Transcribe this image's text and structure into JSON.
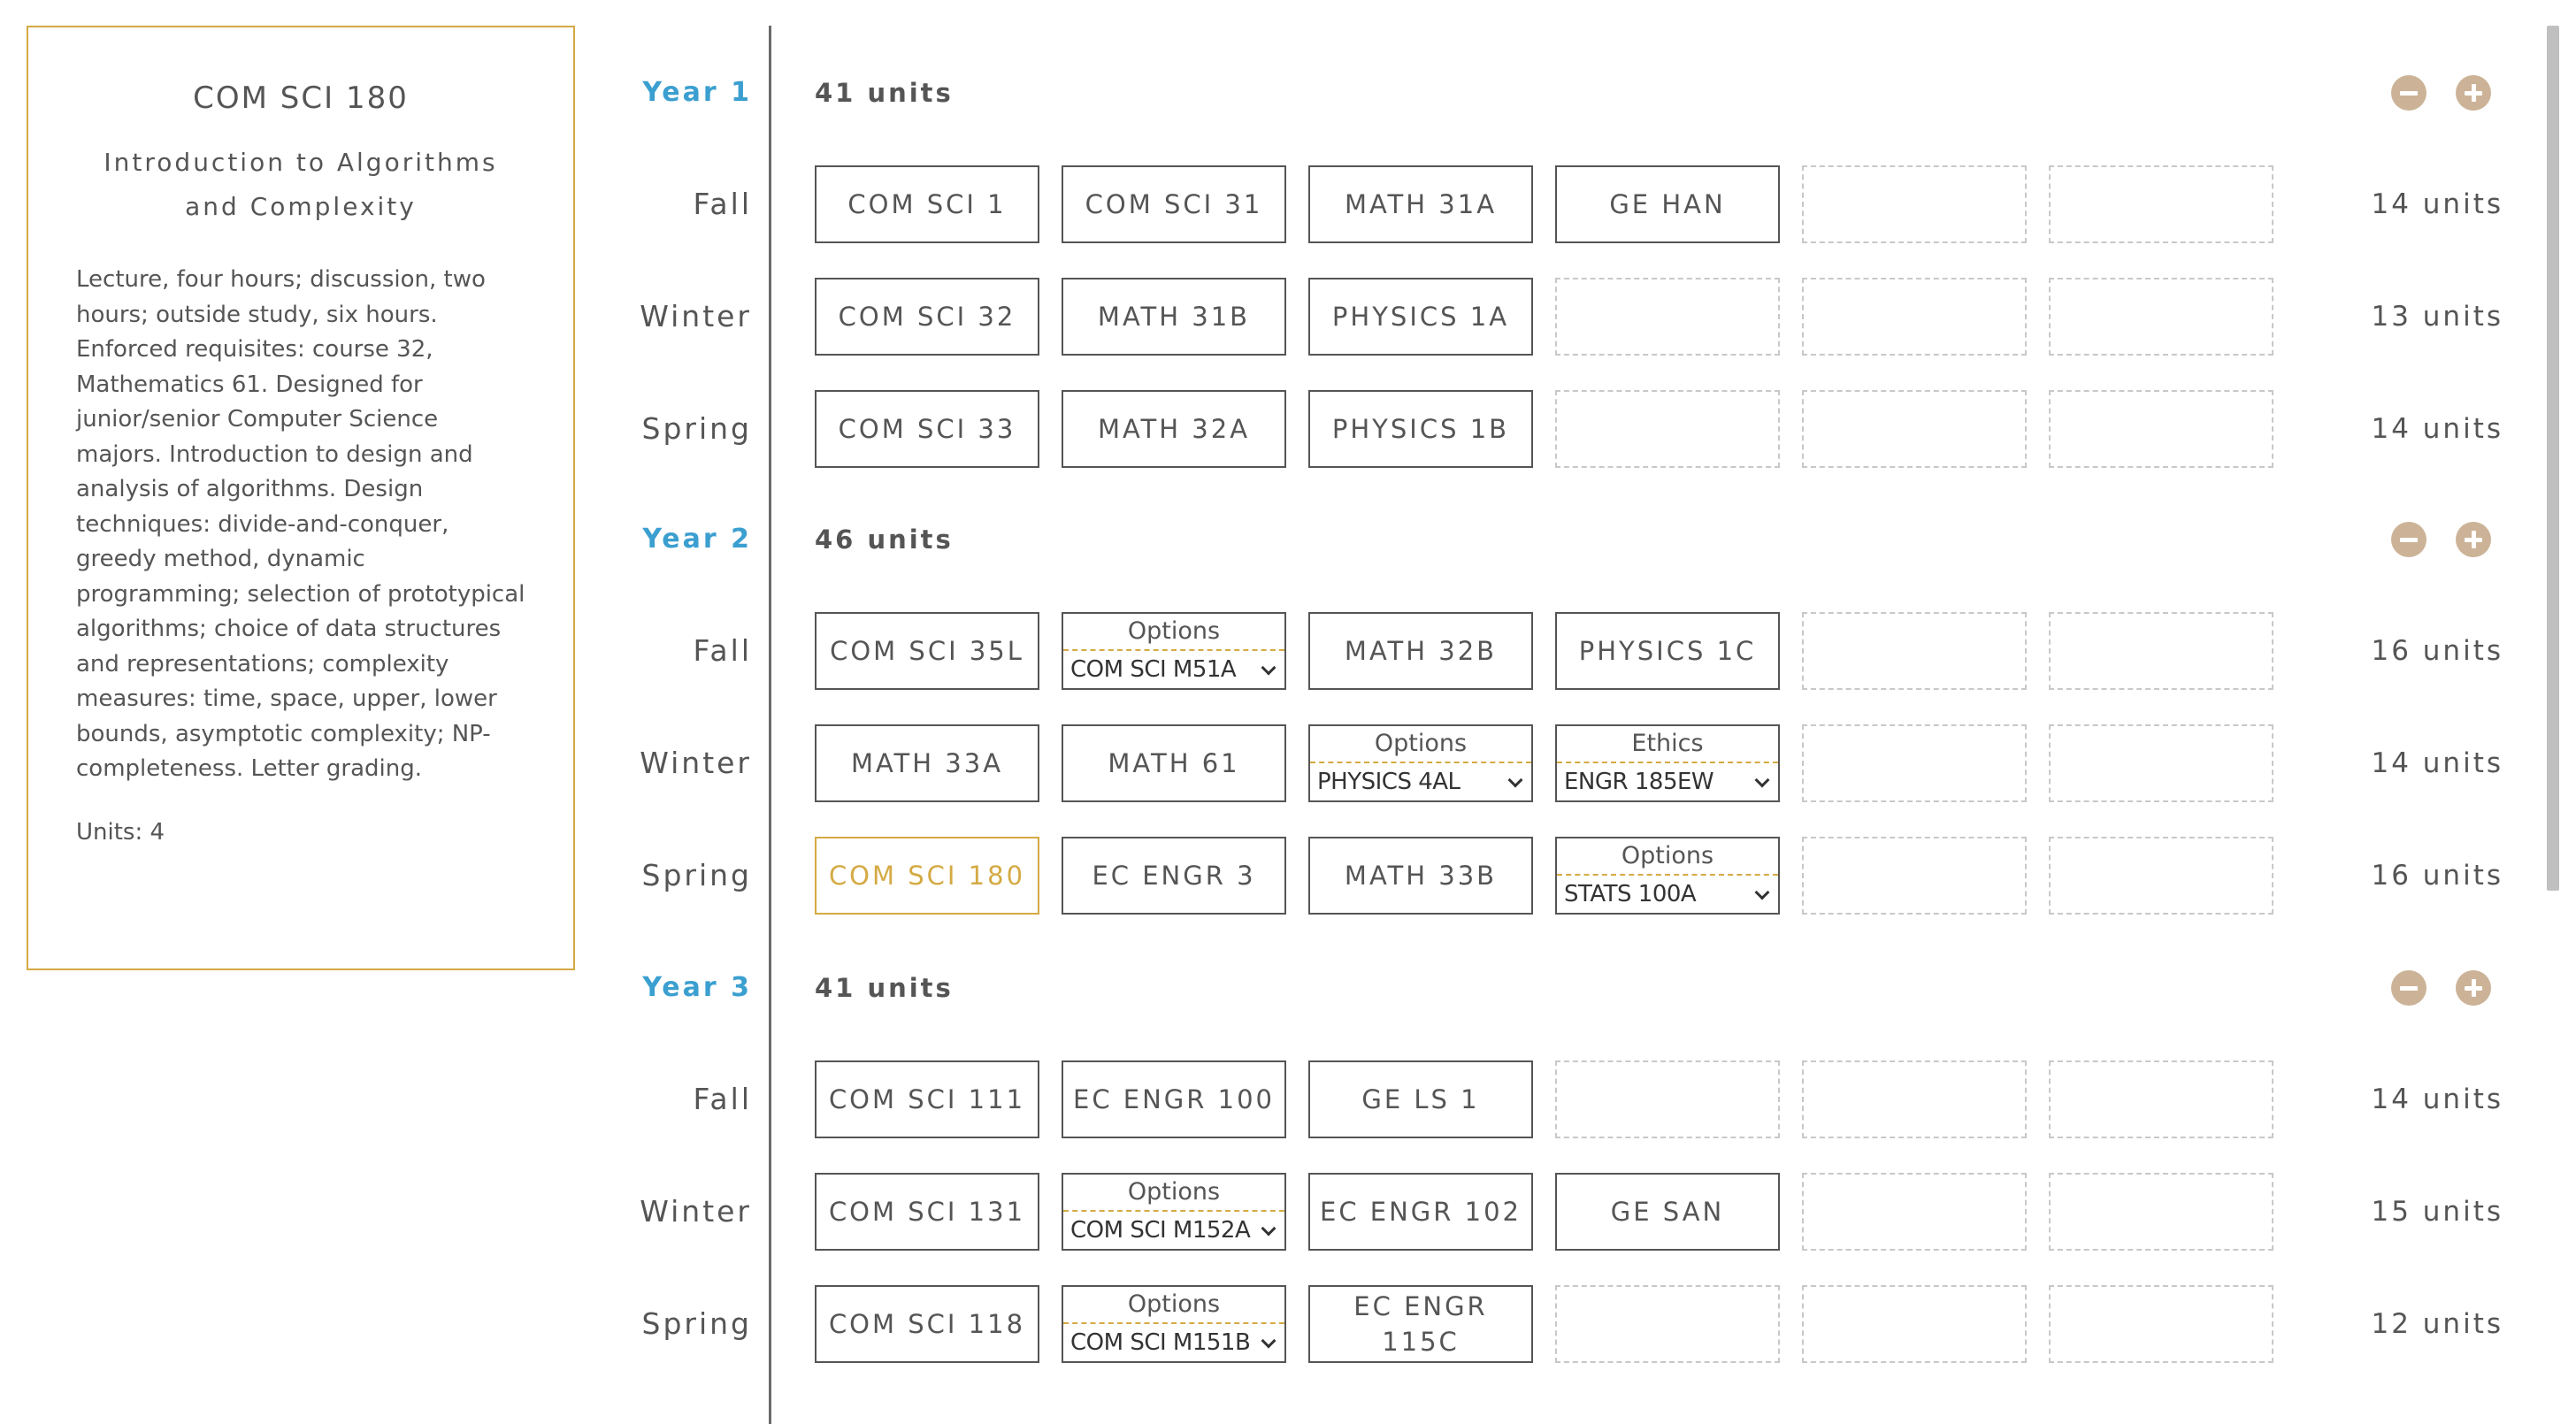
{
  "detail": {
    "code": "COM SCI 180",
    "title": "Introduction to Algorithms and Complexity",
    "description": "Lecture, four hours; discussion, two hours; outside study, six hours. Enforced requisites: course 32, Mathematics 61. Designed for junior/senior Computer Science majors. Introduction to design and analysis of algorithms. Design techniques: divide-and-conquer, greedy method, dynamic programming; selection of prototypical algorithms; choice of data structures and representations; complexity measures: time, space, upper, lower bounds, asymptotic complexity; NP-completeness. Letter grading.",
    "units": "Units: 4"
  },
  "colors": {
    "accent_gold": "#d4aa43",
    "year_blue": "#3b9fd0",
    "control_tan": "#ccb397"
  },
  "icons": {
    "remove_year": "minus-circle-icon",
    "add_year": "plus-circle-icon",
    "dropdown": "chevron-down-icon"
  },
  "years": [
    {
      "label": "Year 1",
      "units": "41 units",
      "terms": [
        {
          "label": "Fall",
          "units": "14 units",
          "slots": [
            {
              "type": "course",
              "text": "COM SCI 1"
            },
            {
              "type": "course",
              "text": "COM SCI 31"
            },
            {
              "type": "course",
              "text": "MATH 31A"
            },
            {
              "type": "course",
              "text": "GE HAN"
            },
            {
              "type": "empty"
            },
            {
              "type": "empty"
            }
          ]
        },
        {
          "label": "Winter",
          "units": "13 units",
          "slots": [
            {
              "type": "course",
              "text": "COM SCI 32"
            },
            {
              "type": "course",
              "text": "MATH 31B"
            },
            {
              "type": "course",
              "text": "PHYSICS 1A"
            },
            {
              "type": "empty"
            },
            {
              "type": "empty"
            },
            {
              "type": "empty"
            }
          ]
        },
        {
          "label": "Spring",
          "units": "14 units",
          "slots": [
            {
              "type": "course",
              "text": "COM SCI 33"
            },
            {
              "type": "course",
              "text": "MATH 32A"
            },
            {
              "type": "course",
              "text": "PHYSICS 1B"
            },
            {
              "type": "empty"
            },
            {
              "type": "empty"
            },
            {
              "type": "empty"
            }
          ]
        }
      ]
    },
    {
      "label": "Year 2",
      "units": "46 units",
      "terms": [
        {
          "label": "Fall",
          "units": "16 units",
          "slots": [
            {
              "type": "course",
              "text": "COM SCI 35L"
            },
            {
              "type": "option",
              "label": "Options",
              "value": "COM SCI M51A"
            },
            {
              "type": "course",
              "text": "MATH 32B"
            },
            {
              "type": "course",
              "text": "PHYSICS 1C"
            },
            {
              "type": "empty"
            },
            {
              "type": "empty"
            }
          ]
        },
        {
          "label": "Winter",
          "units": "14 units",
          "slots": [
            {
              "type": "course",
              "text": "MATH 33A"
            },
            {
              "type": "course",
              "text": "MATH 61"
            },
            {
              "type": "option",
              "label": "Options",
              "value": "PHYSICS 4AL"
            },
            {
              "type": "option",
              "label": "Ethics",
              "value": "ENGR 185EW"
            },
            {
              "type": "empty"
            },
            {
              "type": "empty"
            }
          ]
        },
        {
          "label": "Spring",
          "units": "16 units",
          "slots": [
            {
              "type": "course",
              "text": "COM SCI 180",
              "selected": true
            },
            {
              "type": "course",
              "text": "EC ENGR 3"
            },
            {
              "type": "course",
              "text": "MATH 33B"
            },
            {
              "type": "option",
              "label": "Options",
              "value": "STATS 100A"
            },
            {
              "type": "empty"
            },
            {
              "type": "empty"
            }
          ]
        }
      ]
    },
    {
      "label": "Year 3",
      "units": "41 units",
      "terms": [
        {
          "label": "Fall",
          "units": "14 units",
          "slots": [
            {
              "type": "course",
              "text": "COM SCI 111"
            },
            {
              "type": "course",
              "text": "EC ENGR 100"
            },
            {
              "type": "course",
              "text": "GE LS 1"
            },
            {
              "type": "empty"
            },
            {
              "type": "empty"
            },
            {
              "type": "empty"
            }
          ]
        },
        {
          "label": "Winter",
          "units": "15 units",
          "slots": [
            {
              "type": "course",
              "text": "COM SCI 131"
            },
            {
              "type": "option",
              "label": "Options",
              "value": "COM SCI M152A"
            },
            {
              "type": "course",
              "text": "EC ENGR 102"
            },
            {
              "type": "course",
              "text": "GE SAN"
            },
            {
              "type": "empty"
            },
            {
              "type": "empty"
            }
          ]
        },
        {
          "label": "Spring",
          "units": "12 units",
          "slots": [
            {
              "type": "course",
              "text": "COM SCI 118"
            },
            {
              "type": "option",
              "label": "Options",
              "value": "COM SCI M151B"
            },
            {
              "type": "course",
              "text": "EC ENGR 115C"
            },
            {
              "type": "empty"
            },
            {
              "type": "empty"
            },
            {
              "type": "empty"
            }
          ]
        }
      ]
    }
  ]
}
